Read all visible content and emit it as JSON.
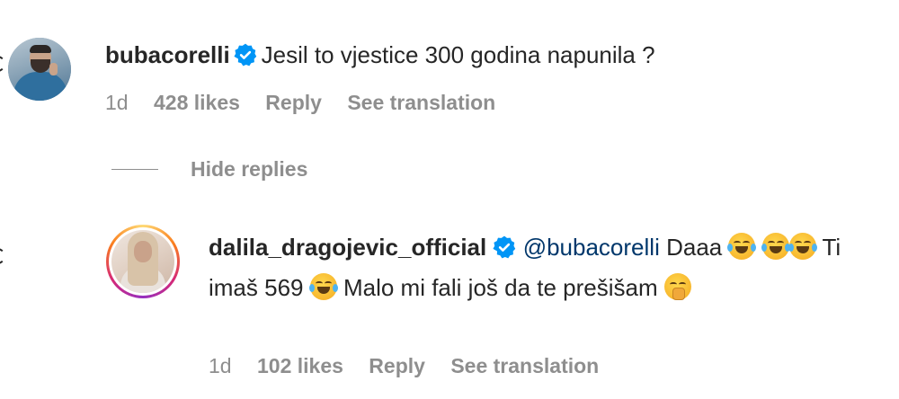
{
  "comments": [
    {
      "username": "bubacorelli",
      "verified": true,
      "text": "Jesil to vjestice 300 godina napunila ?",
      "time": "1d",
      "likes": "428 likes",
      "reply_label": "Reply",
      "translate_label": "See translation"
    }
  ],
  "replies_toggle": {
    "label": "Hide replies"
  },
  "replies": [
    {
      "username": "dalila_dragojevic_official",
      "verified": true,
      "mention": "@bubacorelli",
      "text_part1": "Daaa",
      "text_part2": "Ti imaš 569",
      "text_part3": "Malo mi fali još da te prešišam",
      "time": "1d",
      "likes": "102 likes",
      "reply_label": "Reply",
      "translate_label": "See translation"
    }
  ],
  "colors": {
    "mention": "#00376b",
    "verified": "#0095f6",
    "meta": "#8e8e8e",
    "text": "#262626"
  }
}
